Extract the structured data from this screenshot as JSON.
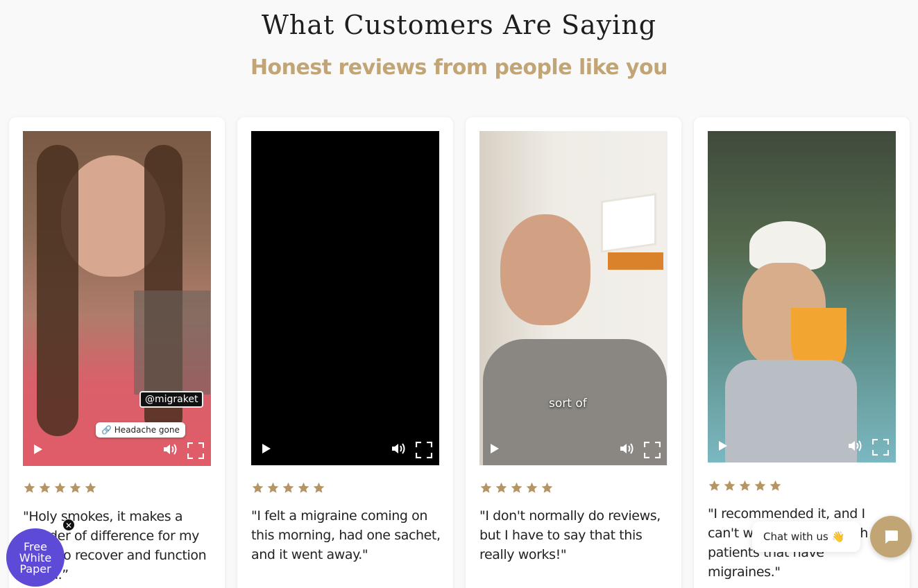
{
  "header": {
    "title": "What Customers Are Saying",
    "subtitle": "Honest reviews from people like you"
  },
  "colors": {
    "accent": "#c2a574",
    "star": "#b59563",
    "widget_purple": "#5d4ad6"
  },
  "reviews": [
    {
      "rating": 5,
      "quote": "\"Holy smokes, it makes a wonder of difference for my body to recover and function again.”",
      "video": {
        "overlay_handle": "@migraket",
        "overlay_link": "Headache gone"
      }
    },
    {
      "rating": 5,
      "quote": "\"I felt a migraine coming on this morning, had one sachet, and it went away.\"",
      "video": {}
    },
    {
      "rating": 5,
      "quote": "\"I don't normally do reviews, but I have to say that this really works!\"",
      "video": {
        "subtitle": "sort of"
      }
    },
    {
      "rating": 5,
      "quote": "\"I recommended it, and I can't wait to share it with patients that have migraines.\"",
      "video": {}
    }
  ],
  "widgets": {
    "white_paper": {
      "line1": "Free",
      "line2": "White",
      "line3": "Paper",
      "close": "✕"
    },
    "chat": {
      "label": "Chat with us",
      "emoji": "👋"
    }
  },
  "icons": {
    "play": "play-icon",
    "volume": "volume-icon",
    "fullscreen": "fullscreen-icon",
    "star": "star-icon",
    "chat": "chat-icon"
  }
}
